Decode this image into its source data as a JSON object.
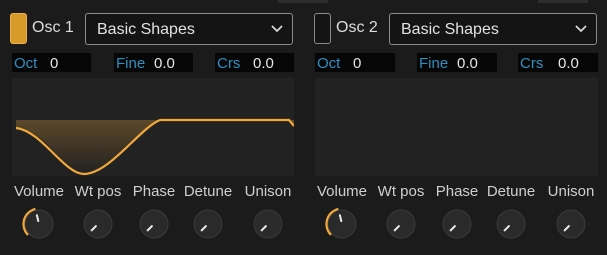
{
  "oscillators": [
    {
      "name": "Osc 1",
      "enabled": true,
      "preset": "Basic Shapes",
      "oct": {
        "label": "Oct",
        "value": "0"
      },
      "fine": {
        "label": "Fine",
        "value": "0.0"
      },
      "crs": {
        "label": "Crs",
        "value": "0.0"
      },
      "waveform": "sine",
      "knobs": [
        {
          "label": "Volume",
          "value": 0.45,
          "active": true
        },
        {
          "label": "Wt pos",
          "value": 0.0,
          "active": false
        },
        {
          "label": "Phase",
          "value": 0.0,
          "active": false
        },
        {
          "label": "Detune",
          "value": 0.0,
          "active": false
        },
        {
          "label": "Unison",
          "value": 0.0,
          "active": false
        }
      ]
    },
    {
      "name": "Osc 2",
      "enabled": false,
      "preset": "Basic Shapes",
      "oct": {
        "label": "Oct",
        "value": "0"
      },
      "fine": {
        "label": "Fine",
        "value": "0.0"
      },
      "crs": {
        "label": "Crs",
        "value": "0.0"
      },
      "waveform": "none",
      "knobs": [
        {
          "label": "Volume",
          "value": 0.45,
          "active": true
        },
        {
          "label": "Wt pos",
          "value": 0.0,
          "active": false
        },
        {
          "label": "Phase",
          "value": 0.0,
          "active": false
        },
        {
          "label": "Detune",
          "value": 0.0,
          "active": false
        },
        {
          "label": "Unison",
          "value": 0.0,
          "active": false
        }
      ]
    }
  ],
  "colors": {
    "accent": "#f2a93b",
    "param_label": "#2f8fc0",
    "knob_body": "#2a2a2a"
  }
}
